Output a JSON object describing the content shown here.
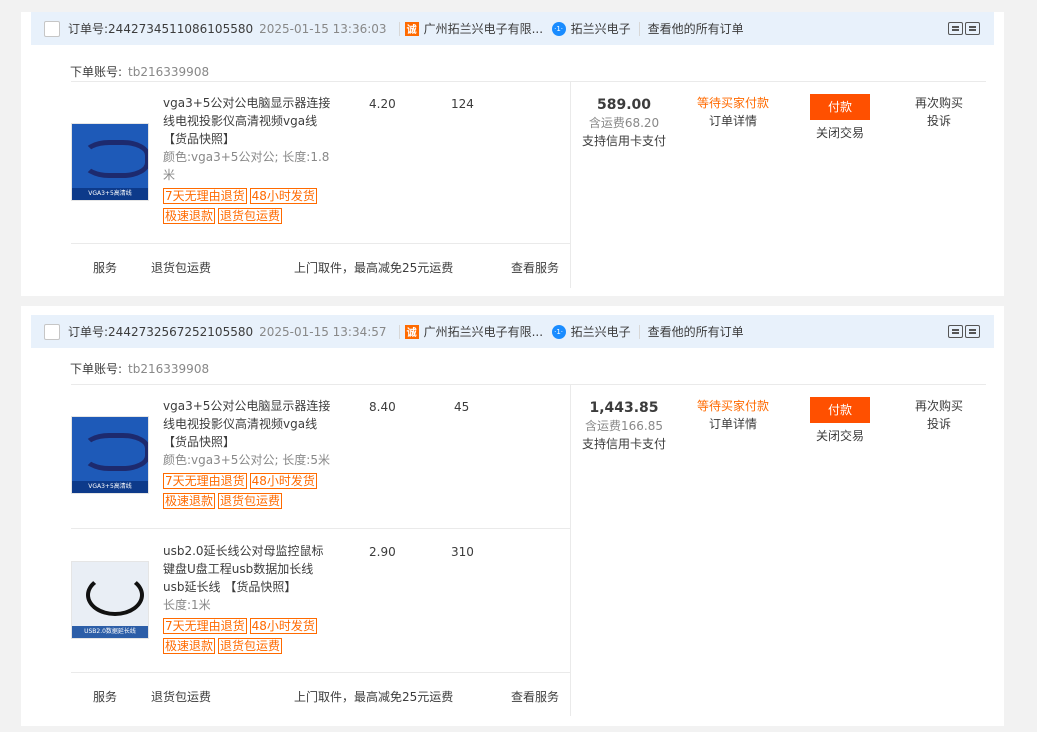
{
  "orders": [
    {
      "order_no_label": "订单号:",
      "order_no": "2442734511086105580",
      "time": "2025-01-15 13:36:03",
      "shop_icon": "诚",
      "shop_name": "广州拓兰兴电子有限...",
      "seller_icon": "·1·",
      "seller": "拓兰兴电子",
      "all_orders": "查看他的所有订单",
      "account_label": "下单账号:",
      "account": "tb216339908",
      "items": [
        {
          "title": "vga3+5公对公电脑显示器连接线电视投影仪高清视频vga线",
          "snapshot": "【货品快照】",
          "attr": "颜色:vga3+5公对公; 长度:1.8米",
          "tags": [
            "7天无理由退货",
            "48小时发货",
            "极速退款",
            "退货包运费"
          ],
          "price": "4.20",
          "qty": "124",
          "image_banner": "VGA3+5高清线"
        }
      ],
      "service": {
        "label": "服务",
        "return_free": "退货包运费",
        "pickup": "上门取件，最高减免25元运费",
        "view": "查看服务"
      },
      "total": "589.00",
      "shipping": "含运费68.20",
      "credit": "支持信用卡支付",
      "status": "等待买家付款",
      "detail": "订单详情",
      "pay": "付款",
      "close": "关闭交易",
      "rebuy": "再次购买",
      "complain": "投诉"
    },
    {
      "order_no_label": "订单号:",
      "order_no": "2442732567252105580",
      "time": "2025-01-15 13:34:57",
      "shop_icon": "诚",
      "shop_name": "广州拓兰兴电子有限...",
      "seller_icon": "·1·",
      "seller": "拓兰兴电子",
      "all_orders": "查看他的所有订单",
      "account_label": "下单账号:",
      "account": "tb216339908",
      "items": [
        {
          "title": "vga3+5公对公电脑显示器连接线电视投影仪高清视频vga线",
          "snapshot": "【货品快照】",
          "attr": "颜色:vga3+5公对公; 长度:5米",
          "tags": [
            "7天无理由退货",
            "48小时发货",
            "极速退款",
            "退货包运费"
          ],
          "price": "8.40",
          "qty": "45",
          "image_banner": "VGA3+5高清线"
        },
        {
          "title": "usb2.0延长线公对母监控鼠标键盘U盘工程usb数据加长线usb延长线",
          "snapshot": "【货品快照】",
          "attr": "长度:1米",
          "tags": [
            "7天无理由退货",
            "48小时发货",
            "极速退款",
            "退货包运费"
          ],
          "price": "2.90",
          "qty": "310",
          "image_banner": "USB2.0数据延长线"
        }
      ],
      "service": {
        "label": "服务",
        "return_free": "退货包运费",
        "pickup": "上门取件，最高减免25元运费",
        "view": "查看服务"
      },
      "total": "1,443.85",
      "shipping": "含运费166.85",
      "credit": "支持信用卡支付",
      "status": "等待买家付款",
      "detail": "订单详情",
      "pay": "付款",
      "close": "关闭交易",
      "rebuy": "再次购买",
      "complain": "投诉"
    }
  ]
}
